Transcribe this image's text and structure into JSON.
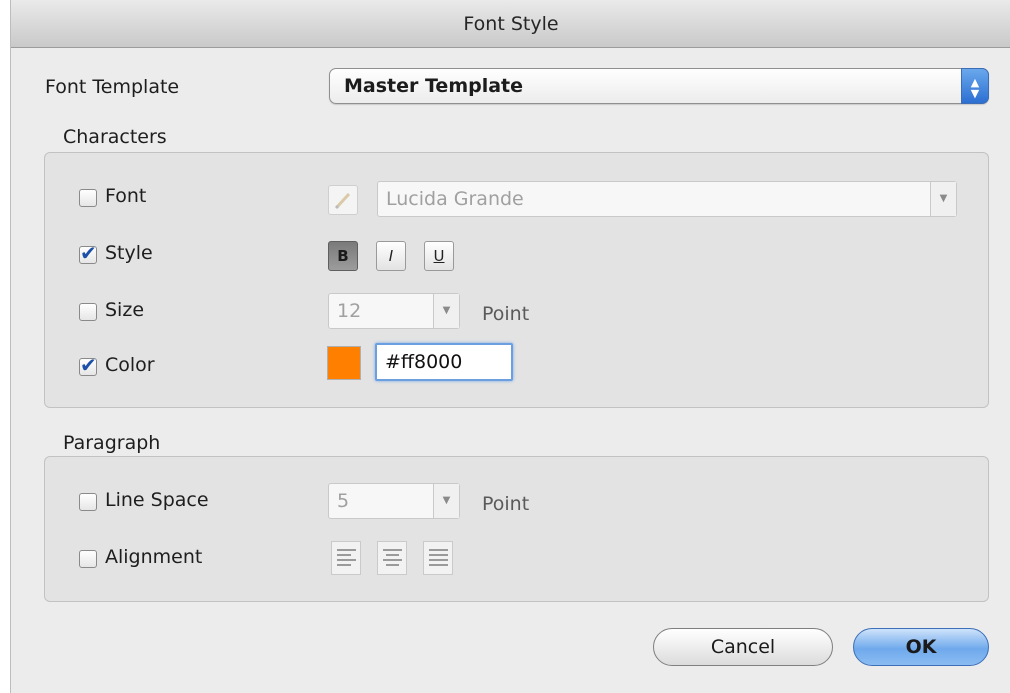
{
  "dialog": {
    "title": "Font Style"
  },
  "template": {
    "label": "Font Template",
    "value": "Master Template"
  },
  "characters": {
    "heading": "Characters",
    "font": {
      "label": "Font",
      "checked": false,
      "value": "Lucida Grande"
    },
    "style": {
      "label": "Style",
      "checked": true,
      "bold": "B",
      "italic": "I",
      "underline": "U",
      "bold_pressed": true
    },
    "size": {
      "label": "Size",
      "checked": false,
      "value": "12",
      "unit": "Point"
    },
    "color": {
      "label": "Color",
      "checked": true,
      "swatch": "#ff8000",
      "value": "#ff8000"
    }
  },
  "paragraph": {
    "heading": "Paragraph",
    "line_space": {
      "label": "Line Space",
      "checked": false,
      "value": "5",
      "unit": "Point"
    },
    "alignment": {
      "label": "Alignment",
      "checked": false
    }
  },
  "buttons": {
    "cancel": "Cancel",
    "ok": "OK"
  },
  "colors": {
    "accent": "#2c6fd2",
    "swatch": "#ff8000"
  }
}
